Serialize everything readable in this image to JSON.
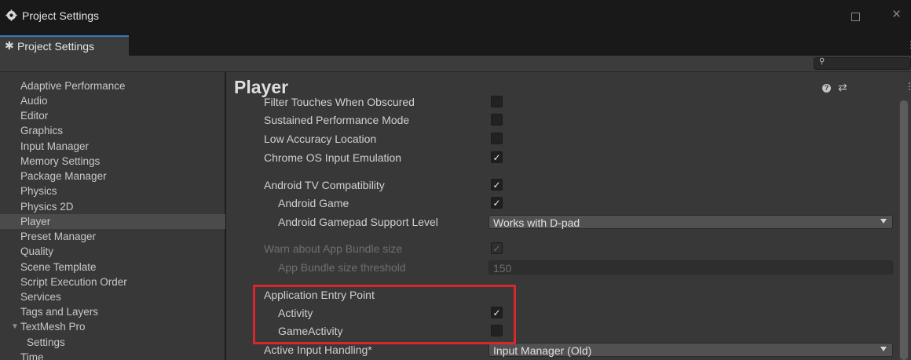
{
  "window": {
    "title": "Project Settings",
    "icon": "unity-cog-icon"
  },
  "tab": {
    "label": "Project Settings",
    "icon": "gear-icon"
  },
  "search": {
    "value": "",
    "placeholder": ""
  },
  "sidebar": {
    "items": [
      {
        "label": "Adaptive Performance"
      },
      {
        "label": "Audio"
      },
      {
        "label": "Editor"
      },
      {
        "label": "Graphics"
      },
      {
        "label": "Input Manager"
      },
      {
        "label": "Memory Settings"
      },
      {
        "label": "Package Manager"
      },
      {
        "label": "Physics"
      },
      {
        "label": "Physics 2D"
      },
      {
        "label": "Player",
        "selected": true
      },
      {
        "label": "Preset Manager"
      },
      {
        "label": "Quality"
      },
      {
        "label": "Scene Template"
      },
      {
        "label": "Script Execution Order"
      },
      {
        "label": "Services"
      },
      {
        "label": "Tags and Layers"
      },
      {
        "label": "TextMesh Pro",
        "expanded": true
      },
      {
        "label": "Settings"
      },
      {
        "label": "Time"
      }
    ]
  },
  "main": {
    "title": "Player",
    "rows": {
      "filter_touches": {
        "label": "Filter Touches When Obscured",
        "checked": false
      },
      "sustained_perf": {
        "label": "Sustained Performance Mode",
        "checked": false
      },
      "low_accuracy": {
        "label": "Low Accuracy Location",
        "checked": false
      },
      "chrome_os": {
        "label": "Chrome OS Input Emulation",
        "checked": true
      },
      "android_tv": {
        "label": "Android TV Compatibility",
        "checked": true
      },
      "android_game": {
        "label": "Android Game",
        "checked": true
      },
      "gamepad_level": {
        "label": "Android Gamepad Support Level",
        "value": "Works with D-pad"
      },
      "warn_bundle": {
        "label": "Warn about App Bundle size",
        "checked": true,
        "disabled": true
      },
      "bundle_threshold": {
        "label": "App Bundle size threshold",
        "value": "150",
        "disabled": true
      },
      "entry_point": {
        "label": "Application Entry Point"
      },
      "activity": {
        "label": "Activity",
        "checked": true
      },
      "game_activity": {
        "label": "GameActivity",
        "checked": false
      },
      "input_handling": {
        "label": "Active Input Handling*",
        "value": "Input Manager (Old)"
      }
    },
    "check_glyph": "✓",
    "highlight_color": "#d6272b"
  }
}
